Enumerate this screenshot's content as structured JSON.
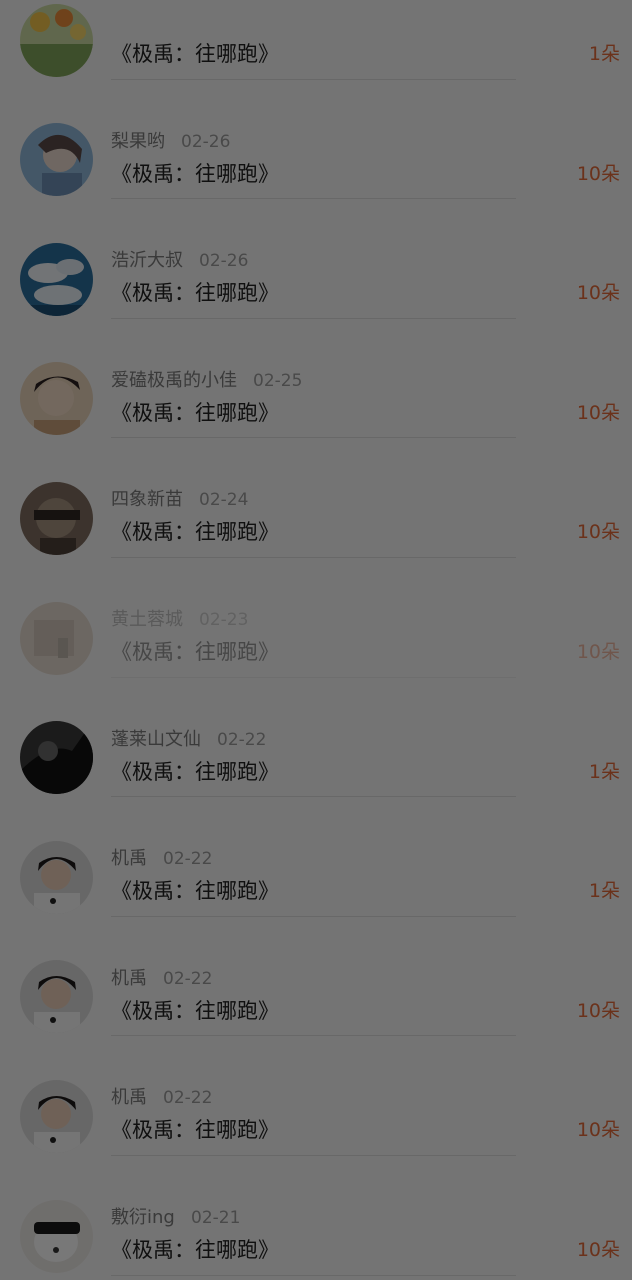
{
  "items": [
    {
      "name": "",
      "date": "",
      "title": "《极禹：往哪跑》",
      "count": "1朵",
      "avatar": "flowers-avatar"
    },
    {
      "name": "梨果哟",
      "date": "02-26",
      "title": "《极禹：往哪跑》",
      "count": "10朵",
      "avatar": "girl-portrait-avatar"
    },
    {
      "name": "浩沂大叔",
      "date": "02-26",
      "title": "《极禹：往哪跑》",
      "count": "10朵",
      "avatar": "clouds-sky-avatar"
    },
    {
      "name": "爱磕极禹的小佳",
      "date": "02-25",
      "title": "《极禹：往哪跑》",
      "count": "10朵",
      "avatar": "boy-portrait-avatar"
    },
    {
      "name": "四象新苗",
      "date": "02-24",
      "title": "《极禹：往哪跑》",
      "count": "10朵",
      "avatar": "blindfold-avatar"
    },
    {
      "name": "黄土蓉城",
      "date": "02-23",
      "title": "《极禹：往哪跑》",
      "count": "10朵",
      "avatar": "beige-photo-avatar"
    },
    {
      "name": "蓬莱山文仙",
      "date": "02-22",
      "title": "《极禹：往哪跑》",
      "count": "1朵",
      "avatar": "dark-figure-avatar"
    },
    {
      "name": "机禹",
      "date": "02-22",
      "title": "《极禹：往哪跑》",
      "count": "1朵",
      "avatar": "boy-white-shirt-avatar"
    },
    {
      "name": "机禹",
      "date": "02-22",
      "title": "《极禹：往哪跑》",
      "count": "10朵",
      "avatar": "boy-white-shirt-avatar"
    },
    {
      "name": "机禹",
      "date": "02-22",
      "title": "《极禹：往哪跑》",
      "count": "10朵",
      "avatar": "boy-white-shirt-avatar"
    },
    {
      "name": "敷衍ing",
      "date": "02-21",
      "title": "《极禹：往哪跑》",
      "count": "10朵",
      "avatar": "white-dog-avatar"
    }
  ]
}
